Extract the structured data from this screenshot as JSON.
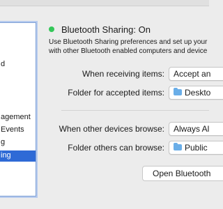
{
  "services": [
    {
      "label": "d",
      "selected": false
    },
    {
      "label": "agement",
      "selected": false
    },
    {
      "label": "Events",
      "selected": false
    },
    {
      "label": "g",
      "selected": false
    },
    {
      "label": "ing",
      "selected": true
    }
  ],
  "status": {
    "text": "Bluetooth Sharing: On",
    "color": "#34c759"
  },
  "description": {
    "line1": "Use Bluetooth Sharing preferences and set up your",
    "line2": "with other Bluetooth enabled computers and device"
  },
  "receiving": {
    "label": "When receiving items:",
    "value": "Accept an"
  },
  "accepted_folder": {
    "label": "Folder for accepted items:",
    "value": "Deskto",
    "icon": "folder-icon"
  },
  "browse": {
    "label": "When other devices browse:",
    "value": "Always Al"
  },
  "browse_folder": {
    "label": "Folder others can browse:",
    "value": "Public",
    "icon": "folder-icon"
  },
  "open_button": {
    "label": "Open Bluetooth"
  },
  "accent": "#2e6ad6"
}
